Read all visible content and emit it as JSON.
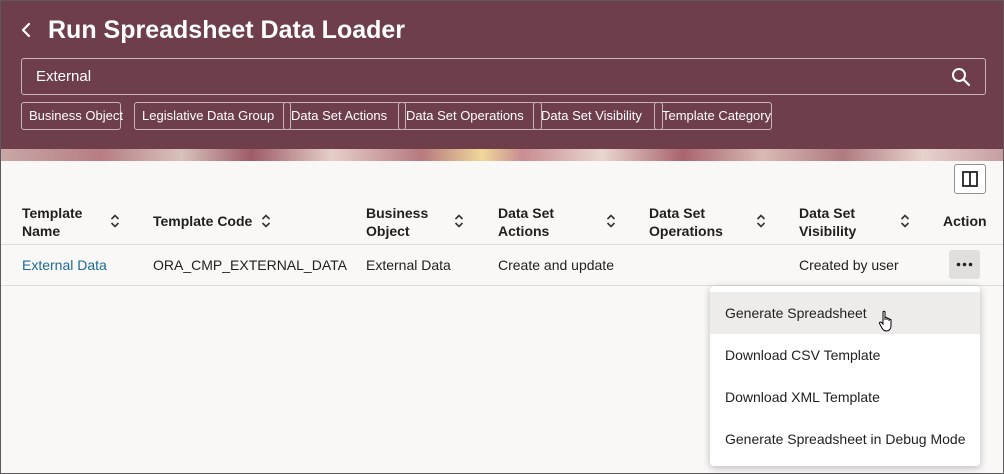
{
  "header": {
    "title": "Run Spreadsheet Data Loader",
    "back_icon": "chevron-left-icon",
    "background": "#6e3f4a"
  },
  "search": {
    "value": "External",
    "icon": "search-icon"
  },
  "filter_chips": [
    "Business Object",
    "Legislative Data Group",
    "Data Set Actions",
    "Data Set Operations",
    "Data Set Visibility",
    "Template Category"
  ],
  "toolbar": {
    "columns_icon": "columns-icon"
  },
  "table": {
    "headers": {
      "template_name_1": "Template",
      "template_name_2": "Name",
      "template_code": "Template Code",
      "business_object_1": "Business",
      "business_object_2": "Object",
      "actions_1": "Data Set",
      "actions_2": "Actions",
      "operations_1": "Data Set",
      "operations_2": "Operations",
      "visibility_1": "Data Set",
      "visibility_2": "Visibility",
      "action": "Action"
    },
    "rows": [
      {
        "template_name": "External Data",
        "template_code": "ORA_CMP_EXTERNAL_DATA",
        "business_object": "External Data",
        "actions": "Create and update",
        "operations": "",
        "visibility": "Created by user"
      }
    ]
  },
  "action_menu": {
    "items": [
      "Generate Spreadsheet",
      "Download CSV Template",
      "Download XML Template",
      "Generate Spreadsheet in Debug Mode"
    ],
    "highlighted_index": 0
  },
  "colors": {
    "link": "#1d6a93",
    "header_bg": "#6e3f4a"
  }
}
